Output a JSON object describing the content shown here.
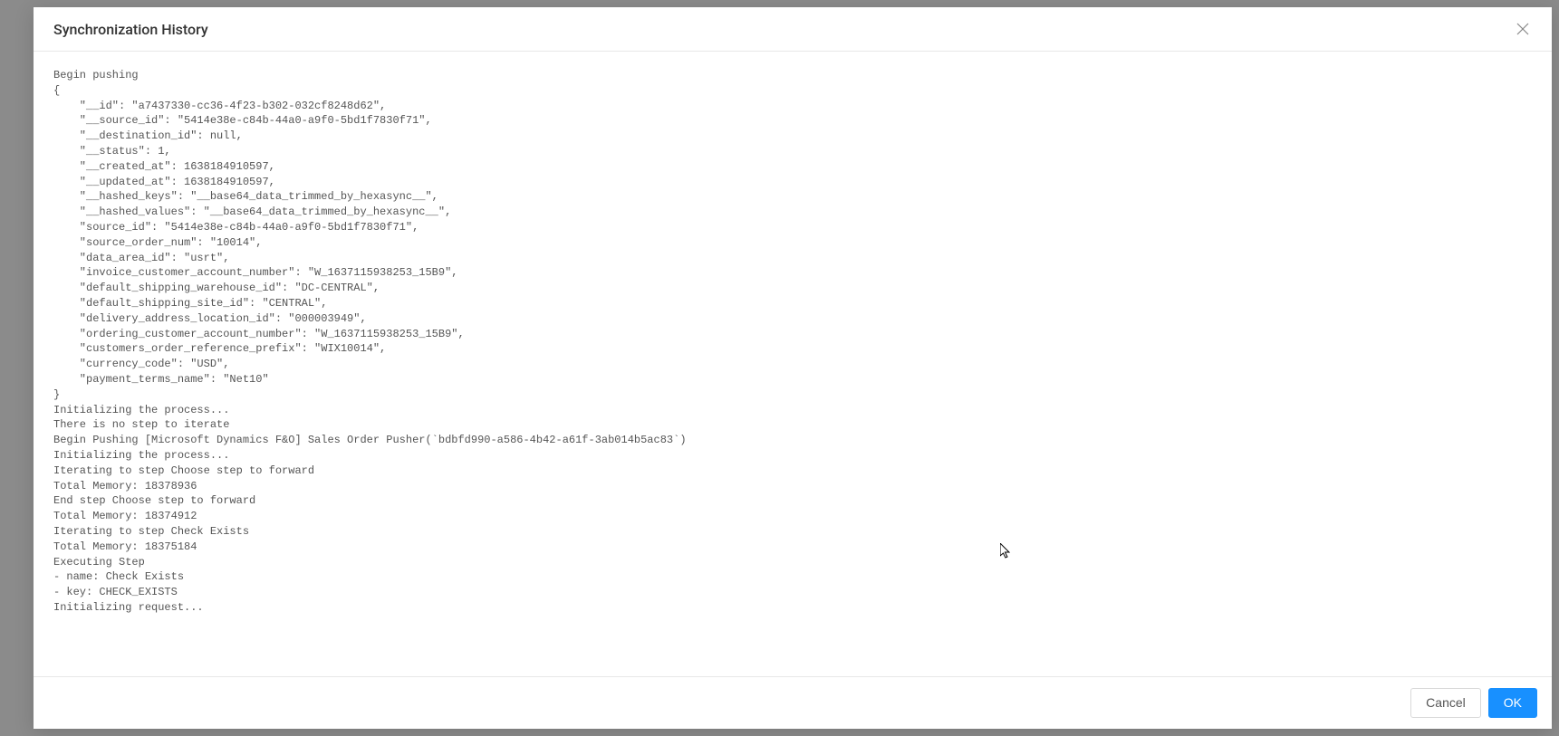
{
  "modal": {
    "title": "Synchronization History",
    "log": "Begin pushing\n{\n    \"__id\": \"a7437330-cc36-4f23-b302-032cf8248d62\",\n    \"__source_id\": \"5414e38e-c84b-44a0-a9f0-5bd1f7830f71\",\n    \"__destination_id\": null,\n    \"__status\": 1,\n    \"__created_at\": 1638184910597,\n    \"__updated_at\": 1638184910597,\n    \"__hashed_keys\": \"__base64_data_trimmed_by_hexasync__\",\n    \"__hashed_values\": \"__base64_data_trimmed_by_hexasync__\",\n    \"source_id\": \"5414e38e-c84b-44a0-a9f0-5bd1f7830f71\",\n    \"source_order_num\": \"10014\",\n    \"data_area_id\": \"usrt\",\n    \"invoice_customer_account_number\": \"W_1637115938253_15B9\",\n    \"default_shipping_warehouse_id\": \"DC-CENTRAL\",\n    \"default_shipping_site_id\": \"CENTRAL\",\n    \"delivery_address_location_id\": \"000003949\",\n    \"ordering_customer_account_number\": \"W_1637115938253_15B9\",\n    \"customers_order_reference_prefix\": \"WIX10014\",\n    \"currency_code\": \"USD\",\n    \"payment_terms_name\": \"Net10\"\n}\nInitializing the process...\nThere is no step to iterate\nBegin Pushing [Microsoft Dynamics F&O] Sales Order Pusher(`bdbfd990-a586-4b42-a61f-3ab014b5ac83`)\nInitializing the process...\nIterating to step Choose step to forward\nTotal Memory: 18378936\nEnd step Choose step to forward\nTotal Memory: 18374912\nIterating to step Check Exists\nTotal Memory: 18375184\nExecuting Step\n- name: Check Exists\n- key: CHECK_EXISTS\nInitializing request...",
    "footer": {
      "cancel_label": "Cancel",
      "ok_label": "OK"
    }
  }
}
